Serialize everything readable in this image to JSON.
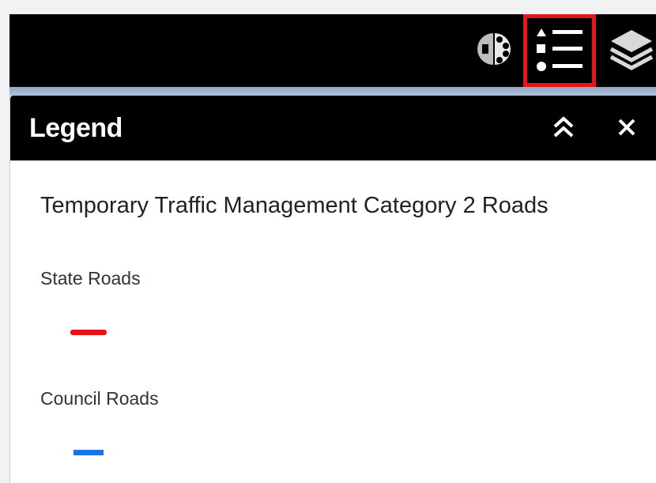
{
  "toolbar": {
    "buttons": [
      {
        "icon": "basemap-gallery-icon"
      },
      {
        "icon": "legend-icon",
        "highlighted": true
      },
      {
        "icon": "layers-icon"
      }
    ],
    "highlight_color": "#e8141b"
  },
  "legend_panel": {
    "title": "Legend",
    "layer_title": "Temporary Traffic Management Category 2 Roads",
    "items": [
      {
        "label": "State Roads",
        "color": "#e8141b"
      },
      {
        "label": "Council Roads",
        "color": "#1a74e8"
      }
    ]
  }
}
